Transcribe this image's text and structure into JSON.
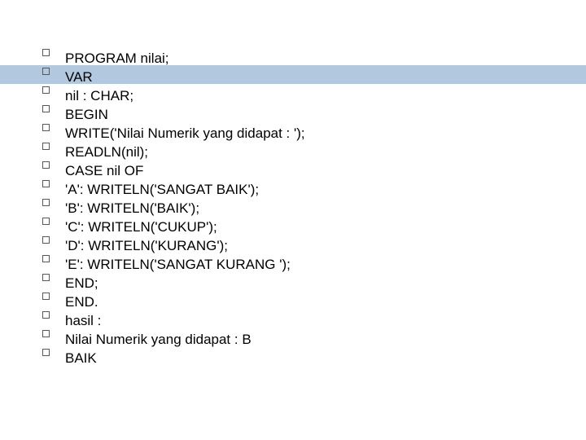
{
  "lines": [
    "PROGRAM nilai;",
    "VAR",
    "nil : CHAR;",
    "BEGIN",
    "WRITE('Nilai Numerik yang didapat : ');",
    "READLN(nil);",
    "CASE nil OF",
    "'A': WRITELN('SANGAT BAIK');",
    "'B': WRITELN('BAIK');",
    "'C': WRITELN('CUKUP');",
    "'D': WRITELN('KURANG');",
    "'E': WRITELN('SANGAT KURANG ');",
    "END;",
    "END.",
    "hasil :",
    "Nilai Numerik yang didapat : B",
    "BAIK"
  ]
}
